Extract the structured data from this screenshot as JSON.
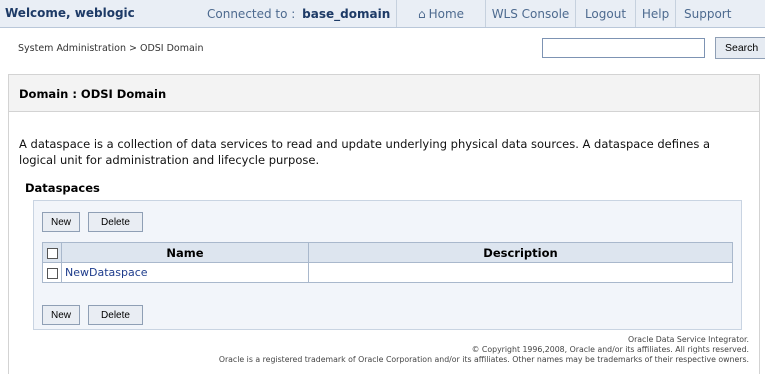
{
  "header": {
    "welcome": "Welcome, weblogic",
    "connected_label": "Connected to :",
    "domain_name": "base_domain",
    "nav": {
      "home": "Home",
      "home_icon": "home-icon",
      "wls_console": "WLS Console",
      "logout": "Logout",
      "help": "Help",
      "support": "Support"
    }
  },
  "breadcrumb": "System Administration > ODSI Domain",
  "search": {
    "value": "",
    "button_label": "Search"
  },
  "panel": {
    "title": "Domain : ODSI Domain",
    "description": "A dataspace is a collection of data services to read and update underlying physical data sources. A dataspace defines a logical unit for administration and lifecycle purpose.",
    "section_title": "Dataspaces",
    "buttons": {
      "new": "New",
      "delete": "Delete"
    },
    "table": {
      "columns": [
        "Name",
        "Description"
      ],
      "rows": [
        {
          "name": "NewDataspace",
          "description": ""
        }
      ]
    }
  },
  "footer": {
    "line1": "Oracle Data Service Integrator.",
    "line2": "© Copyright 1996,2008, Oracle and/or its affiliates. All rights reserved.",
    "line3": "Oracle is a registered trademark of Oracle Corporation and/or its affiliates. Other names may be trademarks of their respective owners."
  },
  "colors": {
    "topbar_bg": "#e9eef5",
    "link": "#1e3c8c",
    "header_text": "#1d3a66"
  }
}
